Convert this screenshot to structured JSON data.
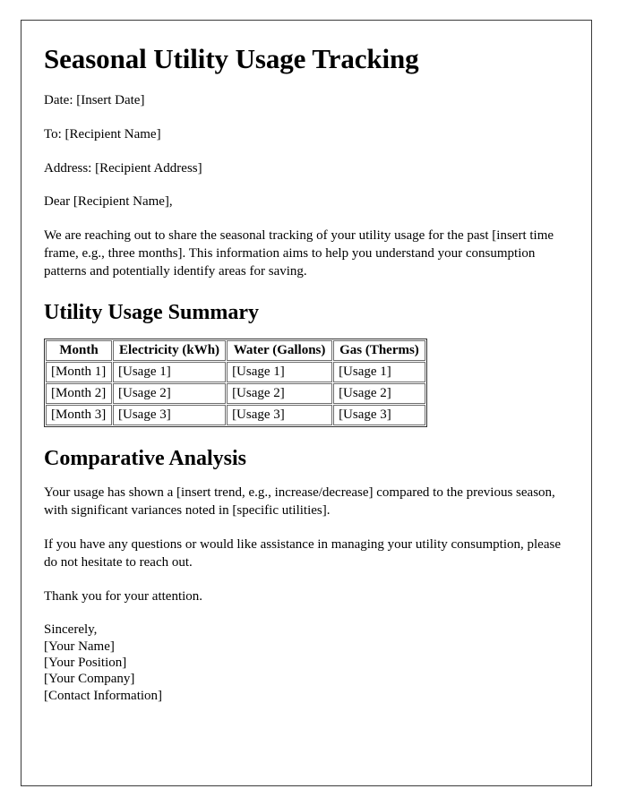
{
  "document": {
    "title": "Seasonal Utility Usage Tracking",
    "header_fields": [
      "Date: [Insert Date]",
      "To: [Recipient Name]",
      "Address: [Recipient Address]"
    ],
    "salutation": "Dear [Recipient Name],",
    "intro_paragraph": "We are reaching out to share the seasonal tracking of your utility usage for the past [insert time frame, e.g., three months]. This information aims to help you understand your consumption patterns and potentially identify areas for saving.",
    "summary_section": {
      "heading": "Utility Usage Summary",
      "table": {
        "columns": [
          "Month",
          "Electricity (kWh)",
          "Water (Gallons)",
          "Gas (Therms)"
        ],
        "rows": [
          [
            "[Month 1]",
            "[Usage 1]",
            "[Usage 1]",
            "[Usage 1]"
          ],
          [
            "[Month 2]",
            "[Usage 2]",
            "[Usage 2]",
            "[Usage 2]"
          ],
          [
            "[Month 3]",
            "[Usage 3]",
            "[Usage 3]",
            "[Usage 3]"
          ]
        ]
      }
    },
    "analysis_section": {
      "heading": "Comparative Analysis",
      "paragraphs": [
        "Your usage has shown a [insert trend, e.g., increase/decrease] compared to the previous season, with significant variances noted in [specific utilities].",
        "If you have any questions or would like assistance in managing your utility consumption, please do not hesitate to reach out.",
        "Thank you for your attention."
      ]
    },
    "signature": {
      "closing": "Sincerely,",
      "lines": [
        "[Your Name]",
        "[Your Position]",
        "[Your Company]",
        "[Contact Information]"
      ]
    }
  }
}
